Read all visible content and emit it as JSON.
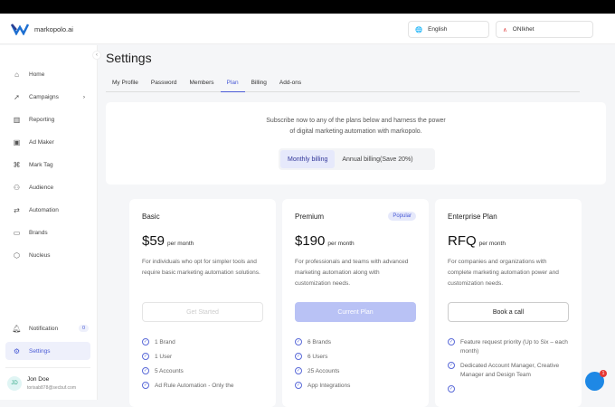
{
  "app": {
    "name": "markopolo.ai"
  },
  "header": {
    "language": "English",
    "workspace": "ONIkhet"
  },
  "sidebar": {
    "items": [
      {
        "label": "Home",
        "icon": "home-icon"
      },
      {
        "label": "Campaigns",
        "icon": "rocket-icon"
      },
      {
        "label": "Reporting",
        "icon": "bar-chart-icon"
      },
      {
        "label": "Ad Maker",
        "icon": "image-icon"
      },
      {
        "label": "Mark Tag",
        "icon": "command-icon"
      },
      {
        "label": "Audience",
        "icon": "users-icon"
      },
      {
        "label": "Automation",
        "icon": "automation-icon"
      },
      {
        "label": "Brands",
        "icon": "folder-icon"
      },
      {
        "label": "Nucleus",
        "icon": "cube-icon"
      }
    ],
    "notification": {
      "label": "Notification",
      "count": "0"
    },
    "settings": "Settings",
    "user": {
      "initials": "JD",
      "name": "Jon Doe",
      "email": "torisab878@secbuf.com"
    }
  },
  "page": {
    "title": "Settings",
    "tabs": [
      "My Profile",
      "Password",
      "Members",
      "Plan",
      "Billing",
      "Add-ons"
    ],
    "active_tab": "Plan"
  },
  "promo": {
    "line1": "Subscribe now to any of the plans below and harness the power",
    "line2": "of digital marketing automation with markopolo.",
    "monthly": "Monthly billing",
    "annual": "Annual billing(Save 20%)"
  },
  "plans": [
    {
      "name": "Basic",
      "price": "$59",
      "period": "per month",
      "desc": "For individuals who opt for simpler tools and require basic marketing automation solutions.",
      "cta": "Get Started",
      "features": [
        "1 Brand",
        "1 User",
        "5 Accounts",
        "Ad Rule Automation - Only the"
      ]
    },
    {
      "name": "Premium",
      "badge": "Popular",
      "price": "$190",
      "period": "per month",
      "desc": "For professionals and teams with advanced marketing automation along with customization needs.",
      "cta": "Current Plan",
      "features": [
        "6 Brands",
        "6 Users",
        "25 Accounts",
        "App Integrations"
      ]
    },
    {
      "name": "Enterprise Plan",
      "price": "RFQ",
      "period": "per month",
      "desc": "For companies and organizations with complete marketing automation power and customization needs.",
      "cta": "Book a call",
      "features": [
        "Feature request priority (Up to Six – each month)",
        "Dedicated Account Manager, Creative Manager and Design Team",
        ""
      ]
    }
  ],
  "chat": {
    "badge": "1"
  },
  "colors": {
    "accent": "#4a5bd6",
    "chat": "#1e88e5"
  }
}
